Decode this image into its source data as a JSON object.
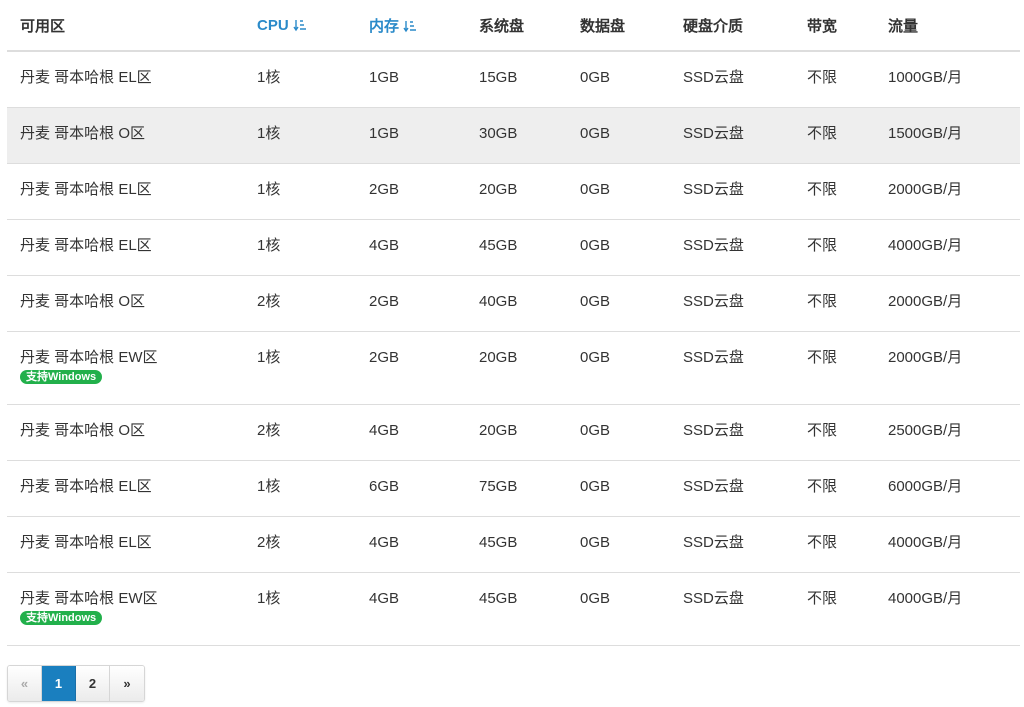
{
  "table": {
    "columns": [
      {
        "label": "可用区",
        "sortable": false
      },
      {
        "label": "CPU",
        "sortable": true
      },
      {
        "label": "内存",
        "sortable": true
      },
      {
        "label": "系统盘",
        "sortable": false
      },
      {
        "label": "数据盘",
        "sortable": false
      },
      {
        "label": "硬盘介质",
        "sortable": false
      },
      {
        "label": "带宽",
        "sortable": false
      },
      {
        "label": "流量",
        "sortable": false
      }
    ],
    "rows": [
      {
        "zone": "丹麦 哥本哈根 EL区",
        "cpu": "1核",
        "memory": "1GB",
        "system_disk": "15GB",
        "data_disk": "0GB",
        "medium": "SSD云盘",
        "bandwidth": "不限",
        "traffic": "1000GB/月",
        "tag": null,
        "highlight": false
      },
      {
        "zone": "丹麦 哥本哈根 O区",
        "cpu": "1核",
        "memory": "1GB",
        "system_disk": "30GB",
        "data_disk": "0GB",
        "medium": "SSD云盘",
        "bandwidth": "不限",
        "traffic": "1500GB/月",
        "tag": null,
        "highlight": true
      },
      {
        "zone": "丹麦 哥本哈根 EL区",
        "cpu": "1核",
        "memory": "2GB",
        "system_disk": "20GB",
        "data_disk": "0GB",
        "medium": "SSD云盘",
        "bandwidth": "不限",
        "traffic": "2000GB/月",
        "tag": null,
        "highlight": false
      },
      {
        "zone": "丹麦 哥本哈根 EL区",
        "cpu": "1核",
        "memory": "4GB",
        "system_disk": "45GB",
        "data_disk": "0GB",
        "medium": "SSD云盘",
        "bandwidth": "不限",
        "traffic": "4000GB/月",
        "tag": null,
        "highlight": false
      },
      {
        "zone": "丹麦 哥本哈根 O区",
        "cpu": "2核",
        "memory": "2GB",
        "system_disk": "40GB",
        "data_disk": "0GB",
        "medium": "SSD云盘",
        "bandwidth": "不限",
        "traffic": "2000GB/月",
        "tag": null,
        "highlight": false
      },
      {
        "zone": "丹麦 哥本哈根 EW区",
        "cpu": "1核",
        "memory": "2GB",
        "system_disk": "20GB",
        "data_disk": "0GB",
        "medium": "SSD云盘",
        "bandwidth": "不限",
        "traffic": "2000GB/月",
        "tag": "支持Windows",
        "highlight": false
      },
      {
        "zone": "丹麦 哥本哈根 O区",
        "cpu": "2核",
        "memory": "4GB",
        "system_disk": "20GB",
        "data_disk": "0GB",
        "medium": "SSD云盘",
        "bandwidth": "不限",
        "traffic": "2500GB/月",
        "tag": null,
        "highlight": false
      },
      {
        "zone": "丹麦 哥本哈根 EL区",
        "cpu": "1核",
        "memory": "6GB",
        "system_disk": "75GB",
        "data_disk": "0GB",
        "medium": "SSD云盘",
        "bandwidth": "不限",
        "traffic": "6000GB/月",
        "tag": null,
        "highlight": false
      },
      {
        "zone": "丹麦 哥本哈根 EL区",
        "cpu": "2核",
        "memory": "4GB",
        "system_disk": "45GB",
        "data_disk": "0GB",
        "medium": "SSD云盘",
        "bandwidth": "不限",
        "traffic": "4000GB/月",
        "tag": null,
        "highlight": false
      },
      {
        "zone": "丹麦 哥本哈根 EW区",
        "cpu": "1核",
        "memory": "4GB",
        "system_disk": "45GB",
        "data_disk": "0GB",
        "medium": "SSD云盘",
        "bandwidth": "不限",
        "traffic": "4000GB/月",
        "tag": "支持Windows",
        "highlight": false
      }
    ]
  },
  "pagination": {
    "prev_label": "«",
    "next_label": "»",
    "pages": [
      "1",
      "2"
    ],
    "current": "1"
  },
  "colors": {
    "sort_header": "#2a8ac9",
    "tag_bg": "#22b04b",
    "row_highlight": "#eeeeee",
    "page_active": "#1a7fbf"
  }
}
